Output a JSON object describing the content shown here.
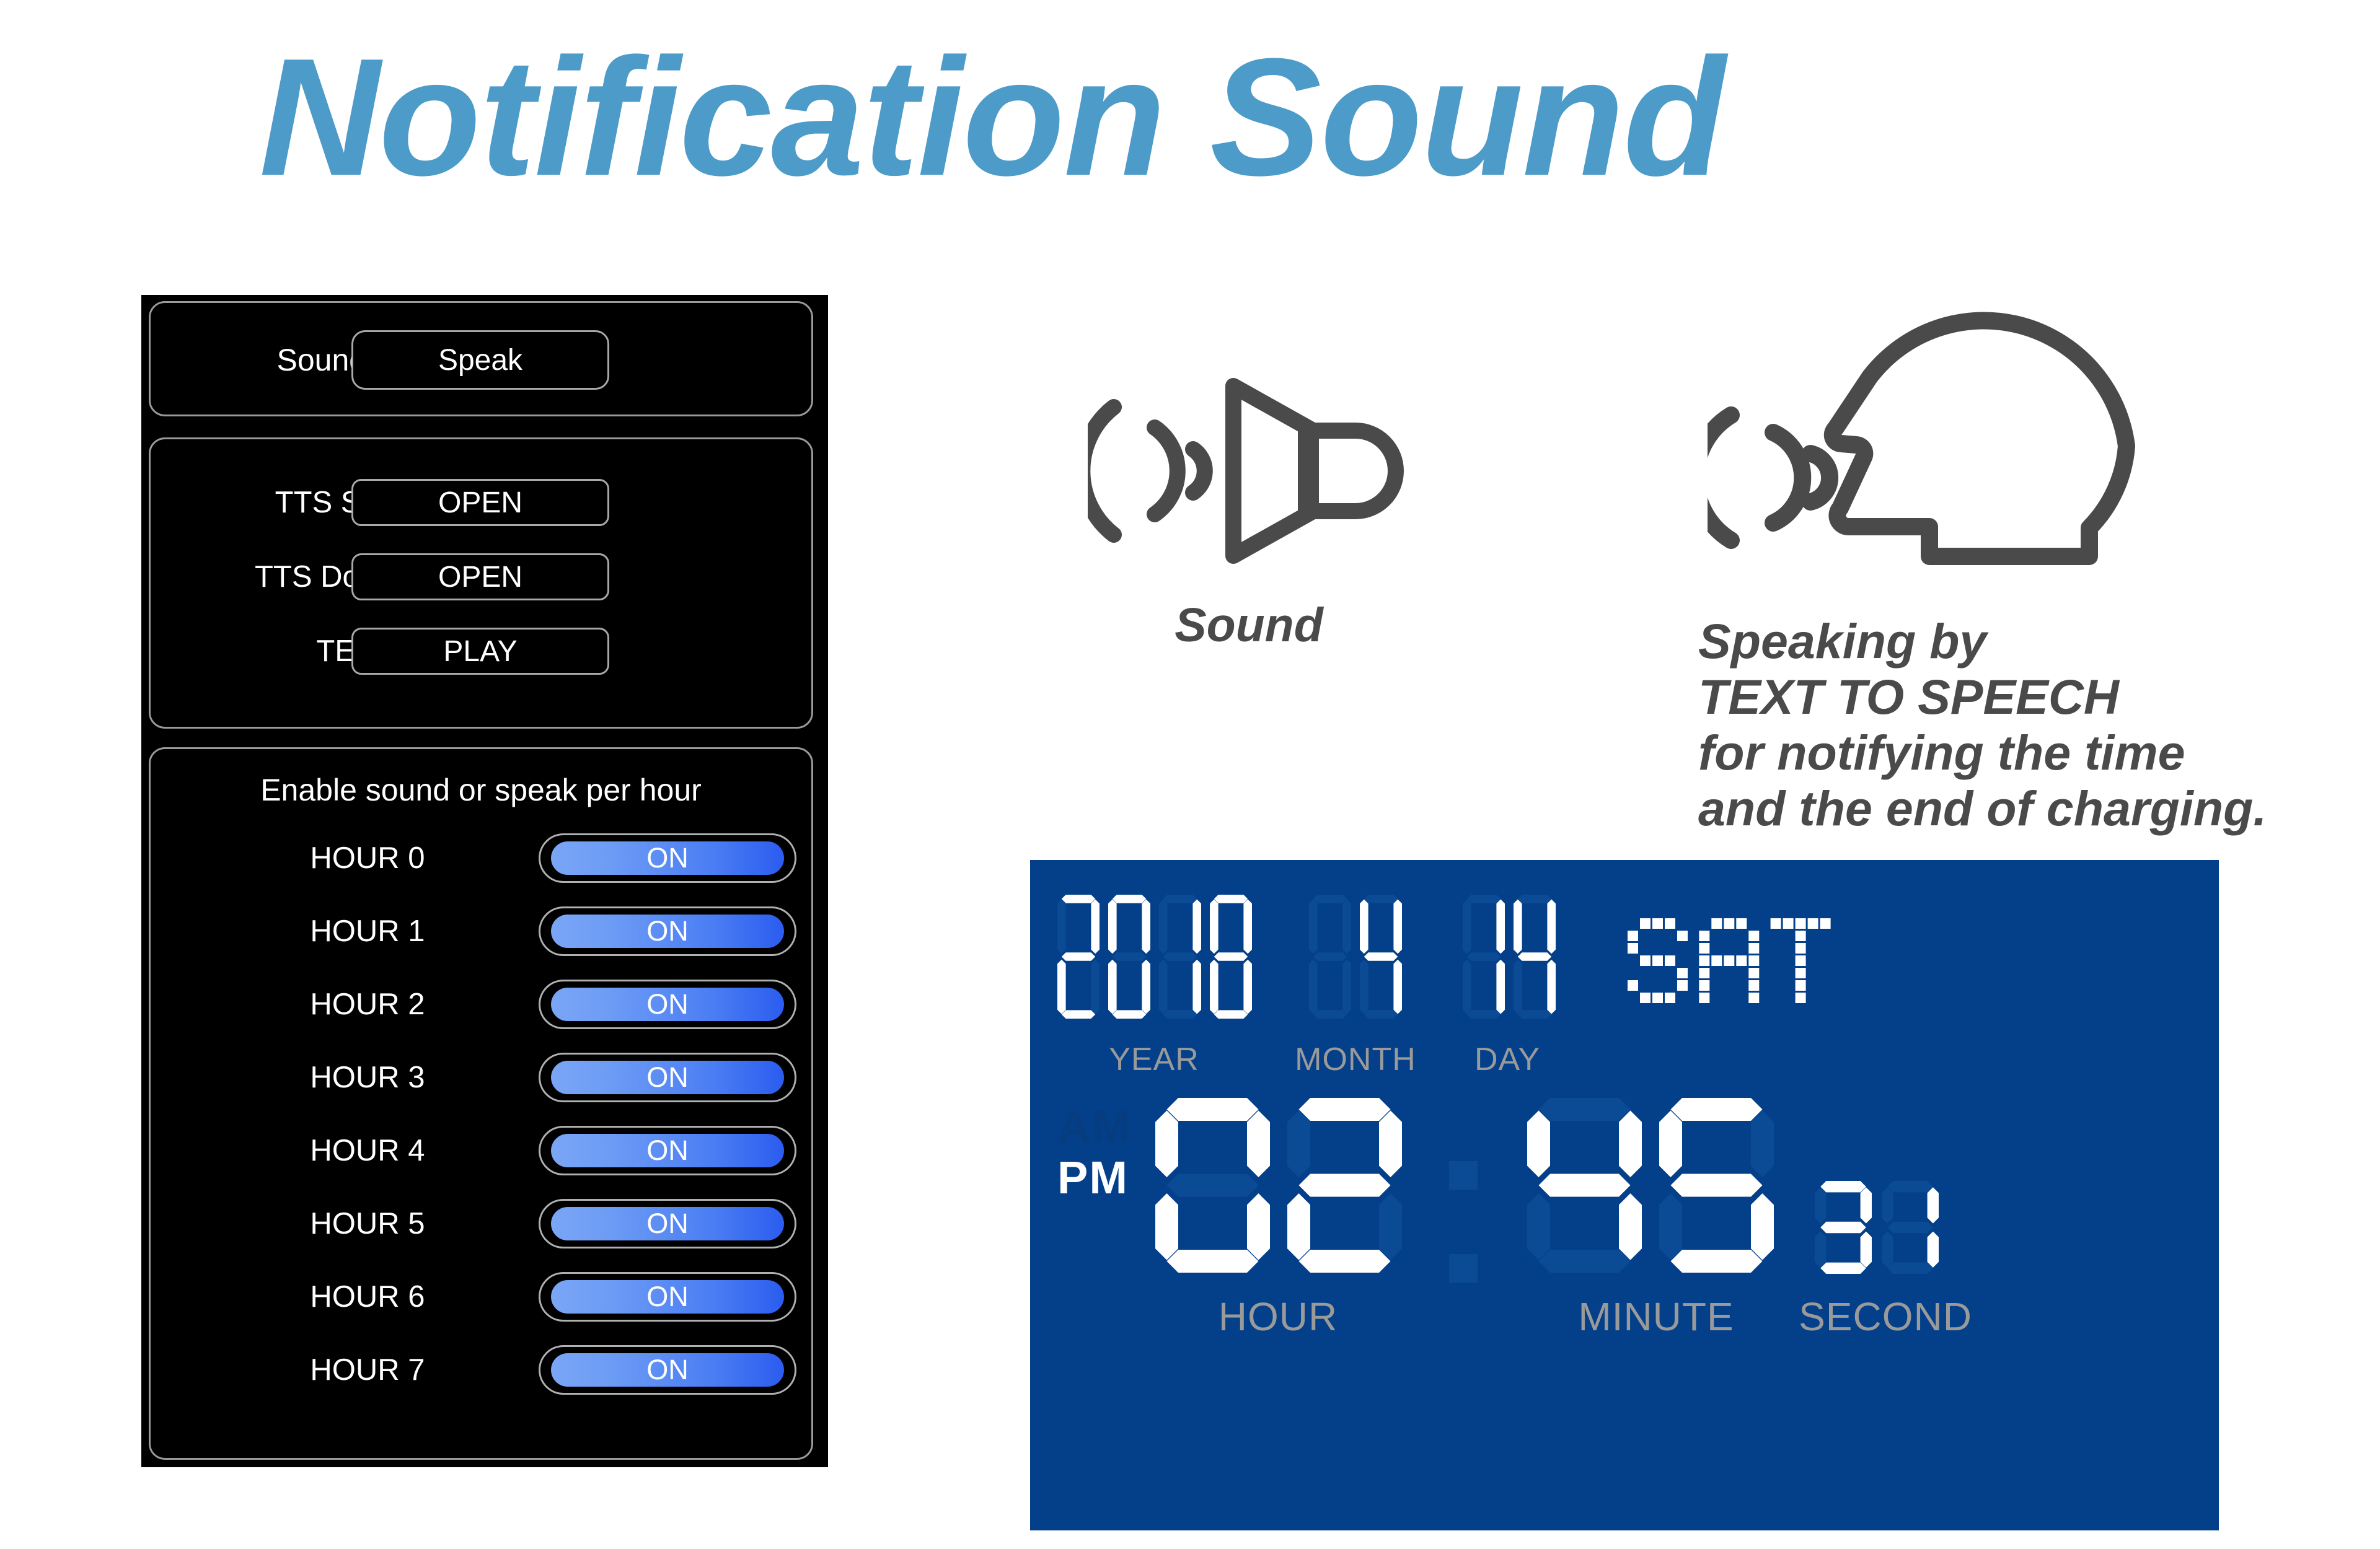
{
  "title": "Notification Sound",
  "phone": {
    "sound_type": {
      "label": "Sound type",
      "value": "Speak"
    },
    "tts": {
      "rows": [
        {
          "label": "TTS Setting",
          "action": "OPEN"
        },
        {
          "label": "TTS Download",
          "action": "OPEN"
        },
        {
          "label": "TEST",
          "action": "PLAY"
        }
      ]
    },
    "hours": {
      "header": "Enable sound or speak per hour",
      "items": [
        {
          "label": "HOUR 0",
          "state": "ON"
        },
        {
          "label": "HOUR 1",
          "state": "ON"
        },
        {
          "label": "HOUR 2",
          "state": "ON"
        },
        {
          "label": "HOUR 3",
          "state": "ON"
        },
        {
          "label": "HOUR 4",
          "state": "ON"
        },
        {
          "label": "HOUR 5",
          "state": "ON"
        },
        {
          "label": "HOUR 6",
          "state": "ON"
        },
        {
          "label": "HOUR 7",
          "state": "ON"
        }
      ]
    }
  },
  "sound_block": {
    "icon": "speaker-waves-icon",
    "caption": "Sound"
  },
  "speech_block": {
    "icon": "head-speaking-icon",
    "line1": "Speaking by",
    "line2": "TEXT TO SPEECH",
    "line3": "for notifying the time",
    "line4": "and the end of charging."
  },
  "clock": {
    "year": "2018",
    "month": "4",
    "day": "14",
    "weekday": "SAT",
    "hour": "02",
    "minute": "45",
    "second": "31",
    "am_label": "AM",
    "pm_label": "PM",
    "meridiem_active": "PM",
    "captions": {
      "year": "YEAR",
      "month": "MONTH",
      "day": "DAY",
      "hour": "HOUR",
      "minute": "MINUTE",
      "second": "SECOND"
    }
  },
  "colors": {
    "title": "#4d9bc9",
    "panel_blue": "#034089",
    "segment_on": "#ffffff",
    "segment_off": "#0b4a95",
    "icon_gray": "#4a4a4a",
    "toggle_from": "#7ba6f6",
    "toggle_to": "#2b5cf0"
  }
}
